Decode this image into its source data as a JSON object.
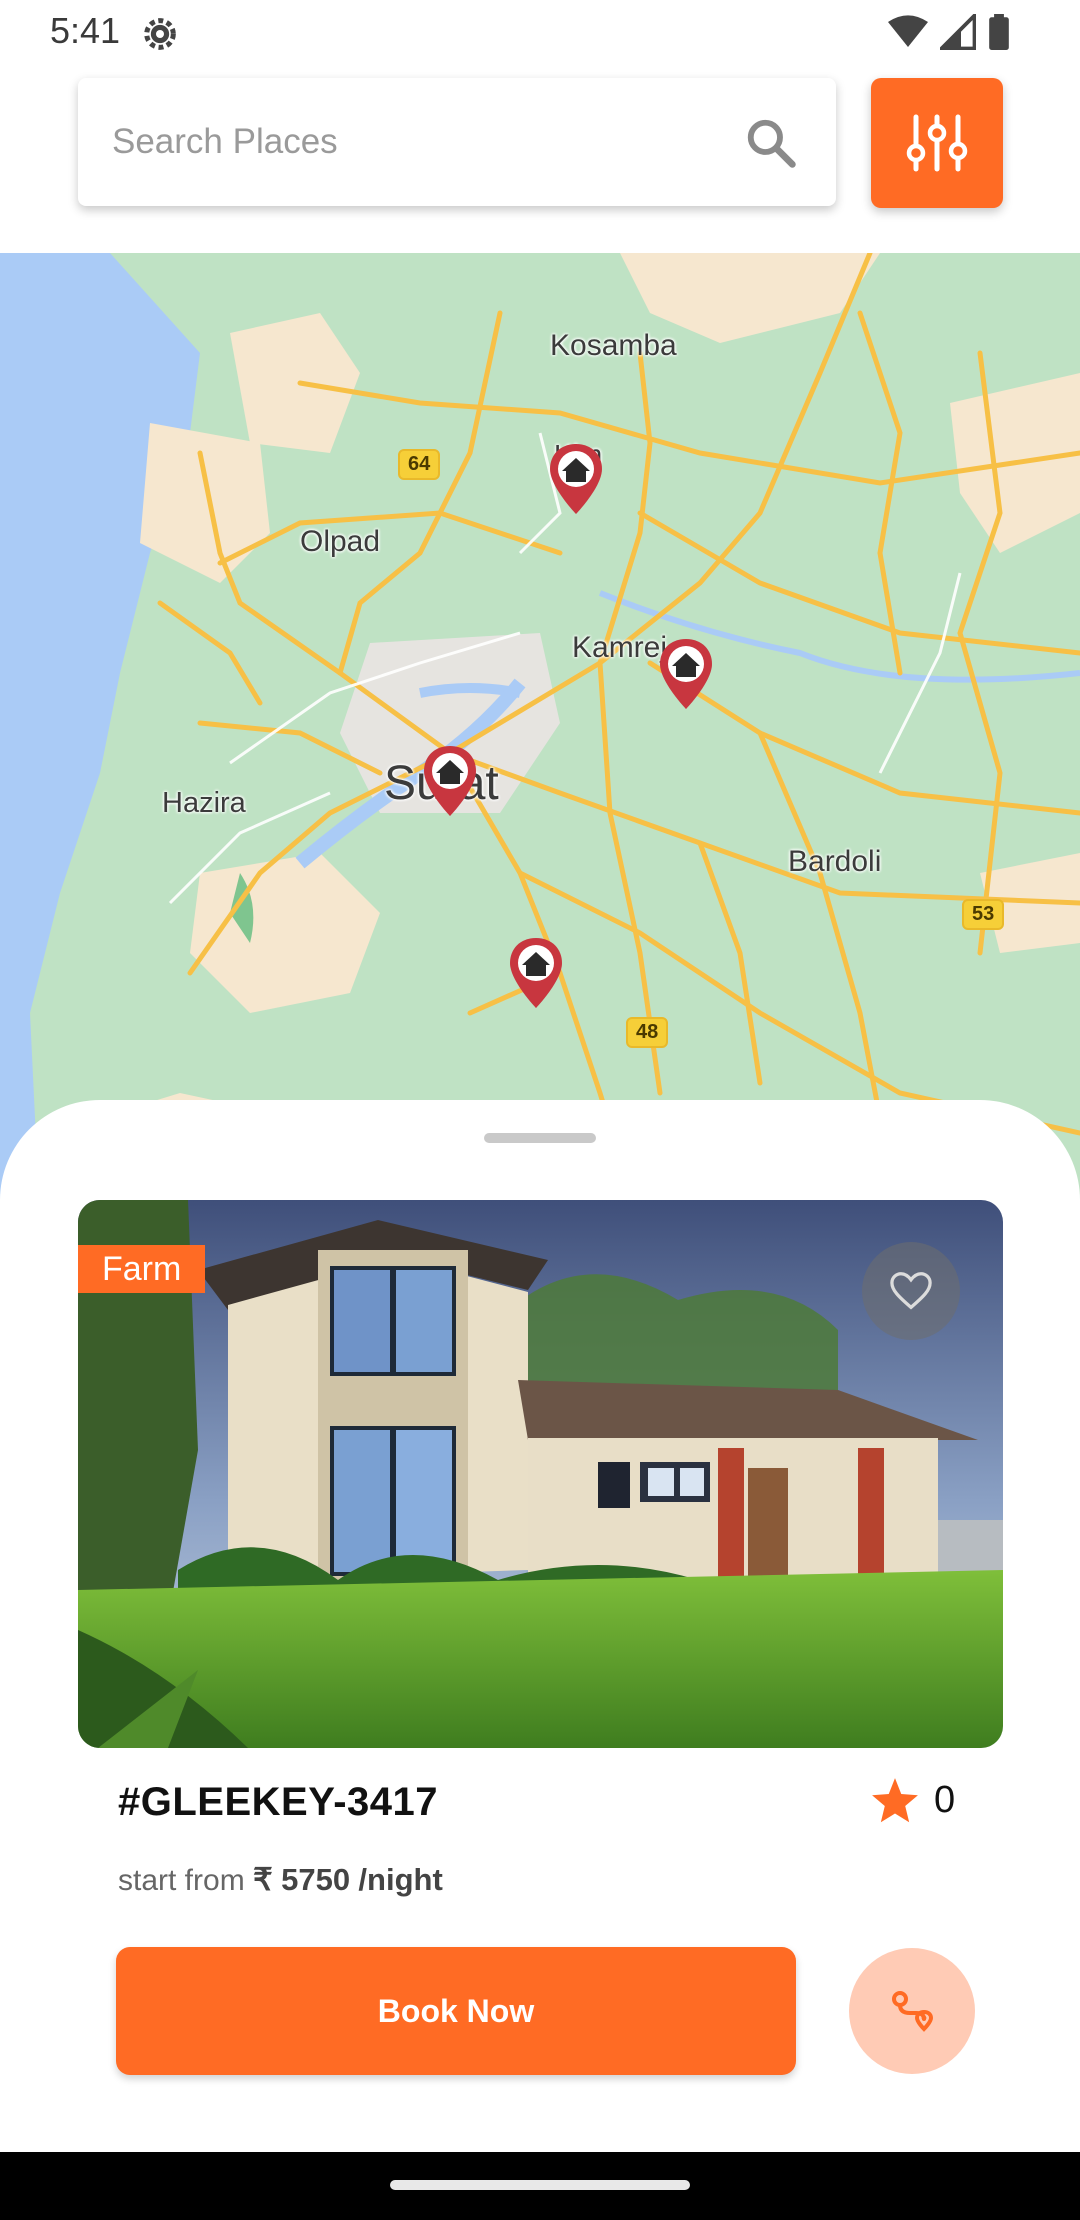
{
  "status_bar": {
    "time": "5:41",
    "icons": [
      "gear-icon",
      "wifi-icon",
      "signal-icon",
      "battery-icon"
    ]
  },
  "search": {
    "placeholder": "Search Places",
    "icon": "search-icon"
  },
  "filter_button": {
    "icon": "sliders-icon"
  },
  "map": {
    "place_labels": {
      "kosamba": "Kosamba",
      "olpad": "Olpad",
      "kim": "Kim",
      "kamrej": "Kamrej",
      "hazira": "Hazira",
      "surat": "Surat",
      "bardoli": "Bardoli"
    },
    "road_shields": {
      "r64": "64",
      "r53": "53",
      "r48": "48"
    },
    "zoom_in_label": "+",
    "markers": [
      "home-marker",
      "home-marker",
      "home-marker",
      "home-marker"
    ]
  },
  "listing": {
    "category_tag": "Farm",
    "title": "#GLEEKEY-3417",
    "rating": "0",
    "price_prefix": "start from",
    "currency": "₹",
    "price": "5750",
    "price_suffix": "/night",
    "book_label": "Book Now"
  },
  "colors": {
    "accent": "#ff6b24",
    "accent_light": "#ffcbb5",
    "marker": "#c8363f",
    "road": "#f7c046",
    "land": "#bfe2c4",
    "water": "#aacbf6"
  }
}
